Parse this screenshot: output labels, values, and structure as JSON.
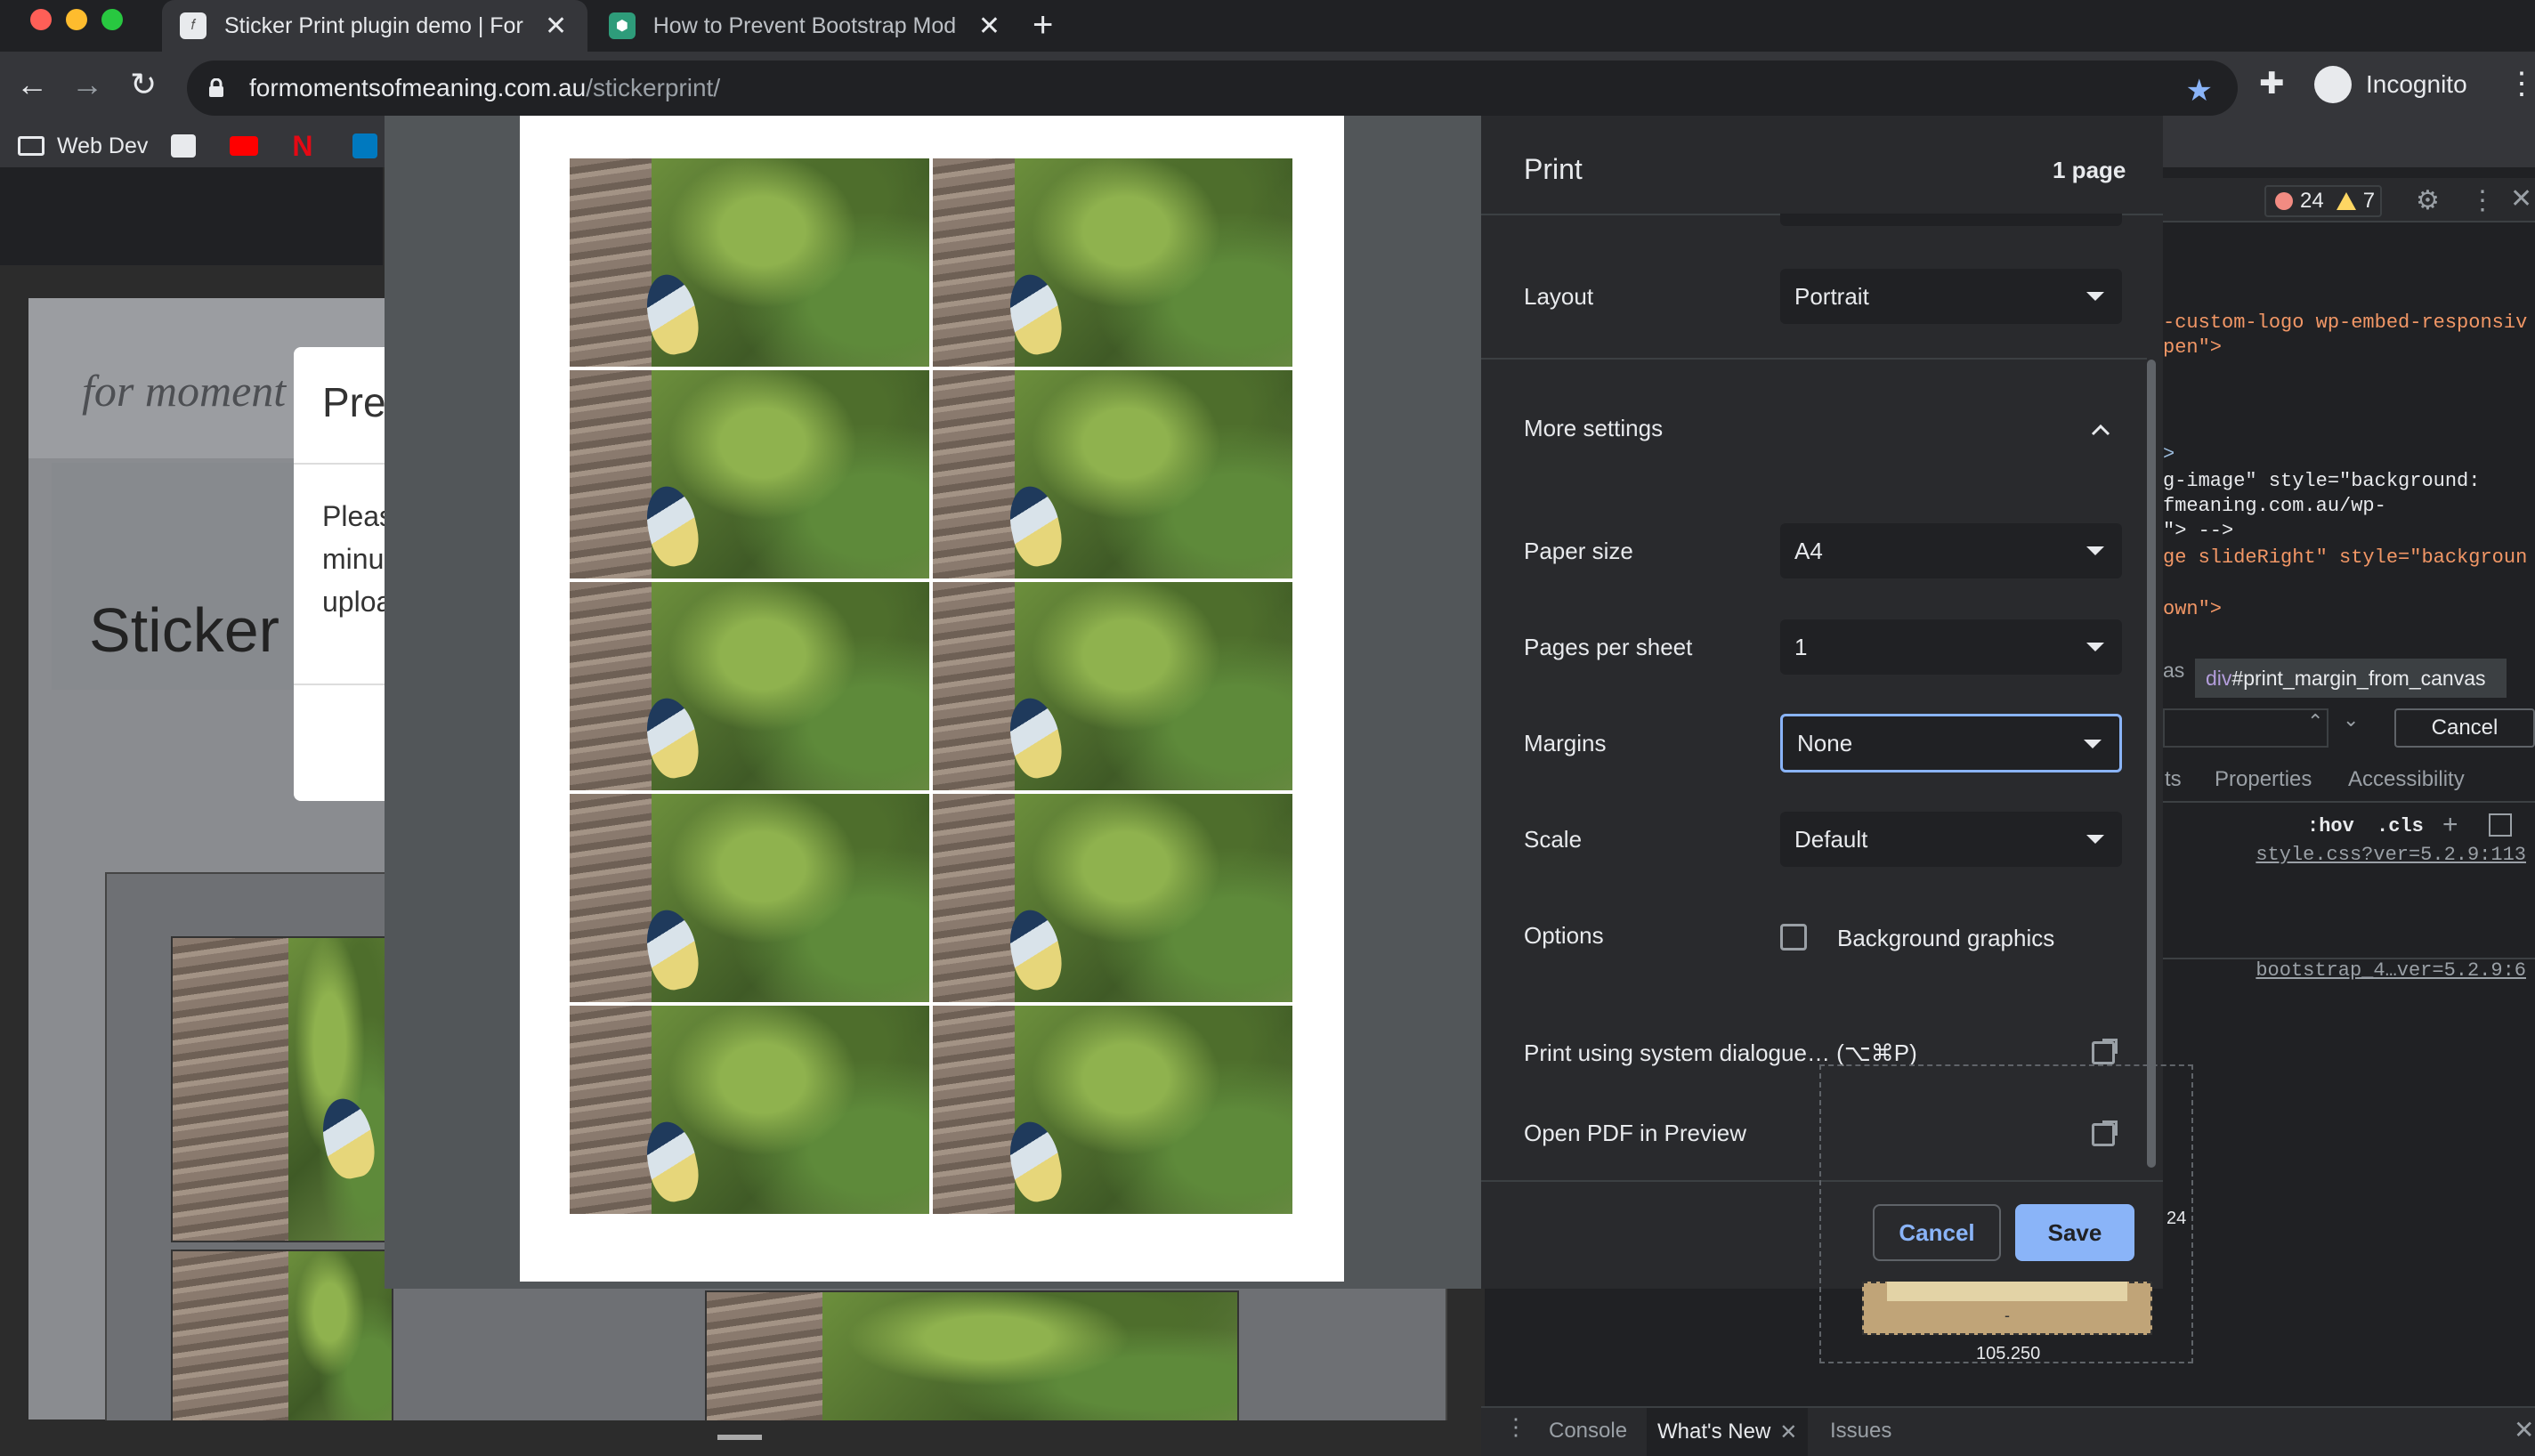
{
  "browser": {
    "tabs": [
      {
        "title": "Sticker Print plugin demo | For",
        "active": true
      },
      {
        "title": "How to Prevent Bootstrap Mod",
        "active": false
      }
    ],
    "url_host": "formomentsofmeaning.com.au",
    "url_path": "/stickerprint/",
    "profile": "Incognito",
    "bookmarks": [
      {
        "label": "Web Dev"
      }
    ]
  },
  "site": {
    "logo": "for moment",
    "heading": "Sticker",
    "modal_title": "Pre",
    "modal_body": "Pleas\nminu\nuploa"
  },
  "print_dialog": {
    "title": "Print",
    "page_count": "1 page",
    "layout_label": "Layout",
    "layout_value": "Portrait",
    "more_settings": "More settings",
    "paper_size_label": "Paper size",
    "paper_size_value": "A4",
    "pages_per_sheet_label": "Pages per sheet",
    "pages_per_sheet_value": "1",
    "margins_label": "Margins",
    "margins_value": "None",
    "scale_label": "Scale",
    "scale_value": "Default",
    "options_label": "Options",
    "background_graphics": "Background graphics",
    "background_graphics_checked": false,
    "system_dialog": "Print using system dialogue… (⌥⌘P)",
    "open_pdf": "Open PDF in Preview",
    "cancel": "Cancel",
    "save": "Save"
  },
  "preview": {
    "stickers": 10
  },
  "devtools": {
    "errors": "24",
    "warnings": "7",
    "code_lines": [
      {
        "text": "-custom-logo wp-embed-responsiv",
        "kind": "attr"
      },
      {
        "text": "pen\">",
        "kind": "val"
      },
      {
        "text": ">",
        "kind": "plain"
      },
      {
        "text": "g-image\" style=\"background:",
        "kind": "plain"
      },
      {
        "text": "fmeaning.com.au/wp-",
        "kind": "plain"
      },
      {
        "text": "\"> -->",
        "kind": "plain"
      },
      {
        "text": "ge slideRight\" style=\"backgroun",
        "kind": "val"
      },
      {
        "text": "own\">",
        "kind": "val"
      }
    ],
    "breadcrumb_prefix": "as",
    "breadcrumb_tag": "div",
    "breadcrumb_id": "#print_margin_from_canvas",
    "search_cancel": "Cancel",
    "tabs": [
      "ts",
      "Properties",
      "Accessibility"
    ],
    "hov": ":hov",
    "cls": ".cls",
    "style_link_1": "style.css?ver=5.2.9:113",
    "style_link_2": "bootstrap_4…ver=5.2.9:6",
    "box_side": "24",
    "box_dash": "-",
    "box_width": "105.250",
    "console_tabs": {
      "console": "Console",
      "whats_new": "What's New",
      "issues": "Issues"
    }
  },
  "colors": {
    "accent": "#8ab4f8",
    "dialog_bg": "#292a2d",
    "chrome_bg": "#35363a"
  }
}
